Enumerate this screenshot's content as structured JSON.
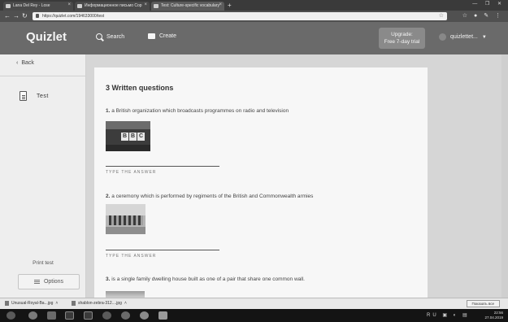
{
  "browser": {
    "tabs": [
      {
        "label": "Lana Del Rey - Lose",
        "active": false
      },
      {
        "label": "Информационное письмо Сор",
        "active": false
      },
      {
        "label": "Test: Culture-specific vocabulary",
        "active": true
      }
    ],
    "url": "https://quizlet.com/194633000/test",
    "window_controls": "— ❐ ✕",
    "ext_icons": "☆ ● ✎ ⋮"
  },
  "header": {
    "logo": "Quizlet",
    "search_label": "Search",
    "create_label": "Create",
    "upgrade_line1": "Upgrade:",
    "upgrade_line2": "Free 7-day trial",
    "username": "quizlettet..."
  },
  "sidebar": {
    "back_label": "Back",
    "mode_label": "Test",
    "print_label": "Print test",
    "options_label": "Options"
  },
  "test": {
    "title": "3 Written questions",
    "answer_label": "TYPE THE ANSWER",
    "questions": [
      {
        "num": "1.",
        "text": "a British organization which broadcasts programmes on radio and television"
      },
      {
        "num": "2.",
        "text": "a ceremony which is performed by regiments of the British and Commonwealth armies"
      },
      {
        "num": "3.",
        "text": "is a single family dwelling house built as one of a pair that share one common wall."
      }
    ],
    "bbc_letters": [
      "B",
      "B",
      "C"
    ]
  },
  "downloads": {
    "items": [
      "Unusual-Royal-Ba...jpg",
      "shablon-zebra-312....jpg"
    ],
    "show_all": "Показать все"
  },
  "taskbar": {
    "lang": "RU",
    "time": "22:56",
    "date": "27.04.2019"
  },
  "colors": {
    "header_bg": "#6a6a6a",
    "page_bg": "#d6d6d6",
    "card_bg": "#f7f7f7"
  }
}
